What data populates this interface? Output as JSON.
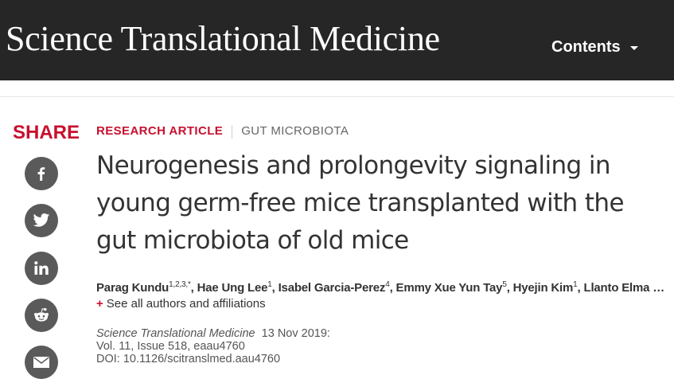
{
  "header": {
    "brand": "Science Translational Medicine",
    "contents_label": "Contents",
    "contents_icon": "chevron-down-icon"
  },
  "share": {
    "label": "SHARE",
    "buttons": [
      {
        "name": "facebook",
        "icon": "facebook-icon"
      },
      {
        "name": "twitter",
        "icon": "twitter-icon"
      },
      {
        "name": "linkedin",
        "icon": "linkedin-icon"
      },
      {
        "name": "reddit",
        "icon": "reddit-icon"
      },
      {
        "name": "email",
        "icon": "email-icon"
      }
    ]
  },
  "article": {
    "type": "RESEARCH ARTICLE",
    "topic": "GUT MICROBIOTA",
    "title": "Neurogenesis and prolongevity signaling in young germ-free mice transplanted with the gut microbiota of old mice",
    "authors": [
      {
        "name": "Parag Kundu",
        "sup": "1,2,3,*"
      },
      {
        "name": "Hae Ung Lee",
        "sup": "1"
      },
      {
        "name": "Isabel Garcia-Perez",
        "sup": "4"
      },
      {
        "name": "Emmy Xue Yun Tay",
        "sup": "5"
      },
      {
        "name": "Hyejin Kim",
        "sup": "1"
      },
      {
        "name": "Llanto Elma",
        "sup": ""
      }
    ],
    "authors_ellipsis": "…",
    "affiliations_toggle": "+",
    "affiliations_link": "See all authors and affiliations",
    "journal": "Science Translational Medicine",
    "date": "13 Nov 2019:",
    "volume": "Vol. 11, Issue 518, eaau4760",
    "doi": "DOI: 10.1126/scitranslmed.aau4760"
  },
  "colors": {
    "topbar": "#262626",
    "accent": "#c8102e",
    "social_icon_bg": "#5a5a5a"
  }
}
